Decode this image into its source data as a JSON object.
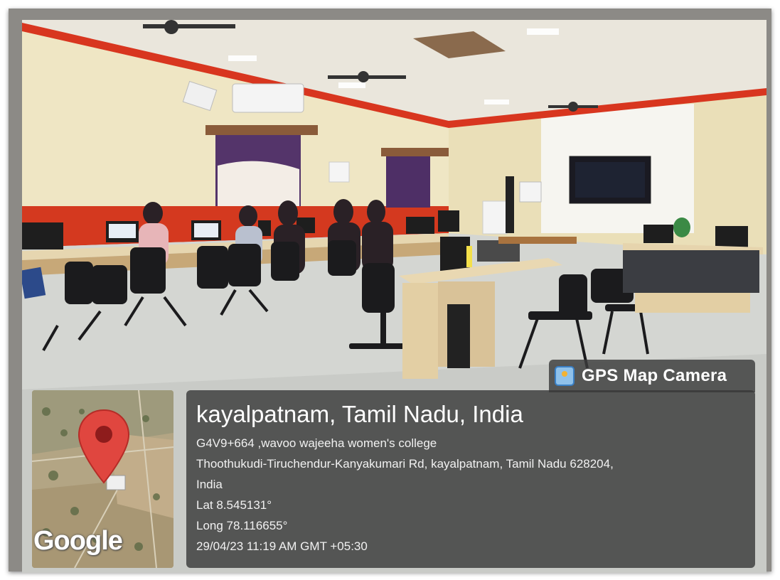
{
  "overlay": {
    "app_badge": "GPS Map Camera",
    "badge_icon": "gps-map-camera-app-icon",
    "location_title": "kayalpatnam, Tamil Nadu, India",
    "plus_code_line": "G4V9+664 ,wavoo wajeeha women's college",
    "address_line_1": "Thoothukudi-Tiruchendur-Kanyakumari Rd, kayalpatnam, Tamil Nadu 628204,",
    "address_line_2": "India",
    "latitude": "Lat 8.545131°",
    "longitude": "Long 78.116655°",
    "datetime": "29/04/23 11:19 AM GMT +05:30"
  },
  "map": {
    "attribution": "Google",
    "pin_color": "#e0463f"
  },
  "colors": {
    "panel_bg": "#373737",
    "wall": "#efe6c4",
    "stripe_red": "#d8361f"
  }
}
